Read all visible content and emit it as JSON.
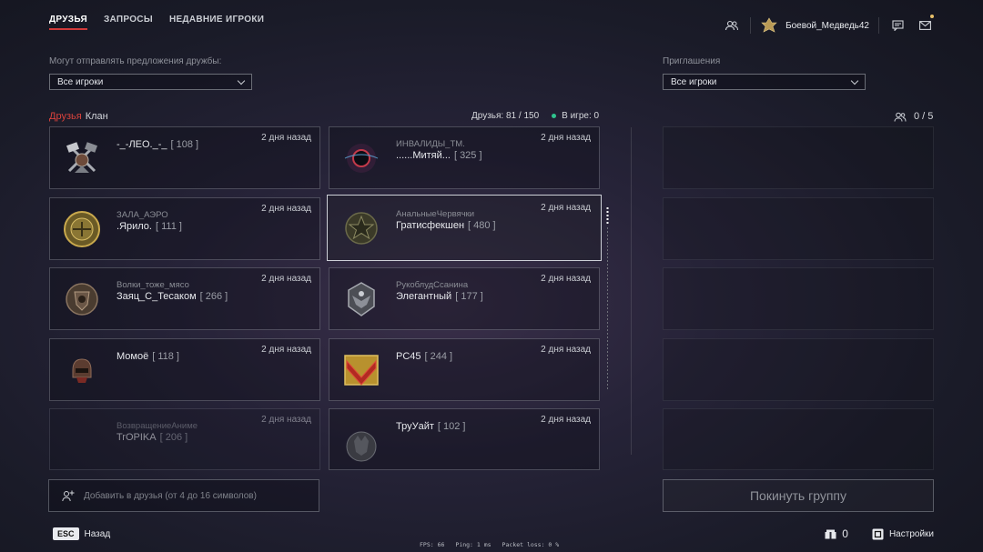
{
  "tabs": [
    {
      "label": "ДРУЗЬЯ",
      "active": true
    },
    {
      "label": "ЗАПРОСЫ",
      "active": false
    },
    {
      "label": "НЕДАВНИЕ ИГРОКИ",
      "active": false
    }
  ],
  "header": {
    "username": "Боевой_Медведь42"
  },
  "left_panel": {
    "filter_label": "Могут отправлять предложения дружбы:",
    "filter_value": "Все игроки",
    "subtabs": [
      {
        "label": "Друзья",
        "active": true
      },
      {
        "label": "Клан",
        "active": false
      }
    ],
    "friends_count": "Друзья: 81 / 150",
    "in_game": "В игре: 0"
  },
  "friends": [
    {
      "clan": "",
      "name": "-_-ЛЕО._-_",
      "level": "[ 108 ]",
      "time": "2 дня назад",
      "avatar": "crossed-flags-emblem-icon"
    },
    {
      "clan": "ИНВАЛИДЫ_ТМ.",
      "name": "......Митяй...",
      "level": "[ 325 ]",
      "time": "2 дня назад",
      "avatar": "dark-planet-emblem-icon"
    },
    {
      "clan": "ЗАЛА_АЭРО",
      "name": ".Ярило.",
      "level": "[ 111 ]",
      "time": "2 дня назад",
      "avatar": "gold-medal-emblem-icon"
    },
    {
      "clan": "АнальныеЧервячки",
      "name": "Гратисфекшен",
      "level": "[ 480 ]",
      "time": "2 дня назад",
      "avatar": "star-emblem-icon"
    },
    {
      "clan": "Волки_тоже_мясо",
      "name": "Заяц_С_Тесаком",
      "level": "[ 266 ]",
      "time": "2 дня назад",
      "avatar": "bronze-shield-emblem-icon"
    },
    {
      "clan": "РукоблудСсанина",
      "name": "Элегантный",
      "level": "[ 177 ]",
      "time": "2 дня назад",
      "avatar": "silver-eagle-emblem-icon"
    },
    {
      "clan": "",
      "name": "Момоё",
      "level": "[ 118 ]",
      "time": "2 дня назад",
      "avatar": "helmet-emblem-icon"
    },
    {
      "clan": "",
      "name": "PC45",
      "level": "[ 244 ]",
      "time": "2 дня назад",
      "avatar": "red-chevron-emblem-icon"
    },
    {
      "clan": "ВозвращениеАниме",
      "name": "TrOPIKA",
      "level": "[ 206 ]",
      "time": "2 дня назад",
      "avatar": "empty-avatar-icon"
    },
    {
      "clan": "",
      "name": "ТруУайт",
      "level": "[ 102 ]",
      "time": "2 дня назад",
      "avatar": "wolf-emblem-icon"
    }
  ],
  "right_panel": {
    "invites_label": "Приглашения",
    "invites_value": "Все игроки",
    "group_count": "0 / 5",
    "leave_label": "Покинуть группу"
  },
  "add_friend": {
    "placeholder": "Добавить в друзья (от 4 до 16 символов)"
  },
  "footer": {
    "esc_key": "ESC",
    "back_label": "Назад",
    "fps": "FPS: 66",
    "ping": "Ping: 1 ms",
    "packet_loss": "Packet loss: 0 %",
    "currency": "0",
    "settings_label": "Настройки"
  }
}
